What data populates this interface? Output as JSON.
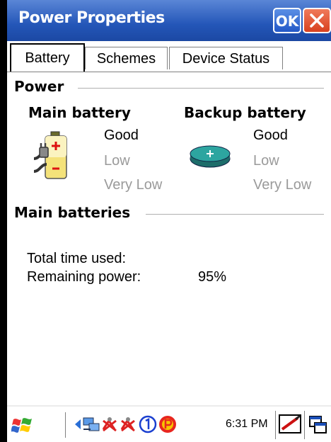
{
  "window": {
    "title": "Power Properties",
    "ok_label": "OK"
  },
  "tabs": [
    {
      "label": "Battery",
      "active": true
    },
    {
      "label": "Schemes",
      "active": false
    },
    {
      "label": "Device Status",
      "active": false
    }
  ],
  "power_group": {
    "title": "Power",
    "main_battery": {
      "label": "Main battery",
      "levels": [
        "Good",
        "Low",
        "Very Low"
      ],
      "current_level": "Good"
    },
    "backup_battery": {
      "label": "Backup battery",
      "levels": [
        "Good",
        "Low",
        "Very Low"
      ],
      "current_level": "Good"
    }
  },
  "main_batteries_group": {
    "title": "Main batteries",
    "total_time_label": "Total time used:",
    "total_time_value": "",
    "remaining_label": "Remaining power:",
    "remaining_value": "95%"
  },
  "taskbar": {
    "clock": "6:31 PM",
    "tray_icons": [
      "back-arrow-icon",
      "network-icon",
      "disconnected-icon",
      "disconnected-icon",
      "number-one-icon",
      "p-icon"
    ]
  },
  "colors": {
    "titlebar": "#2456b8",
    "close": "#d8411f",
    "dim_text": "#9a9a9a"
  }
}
